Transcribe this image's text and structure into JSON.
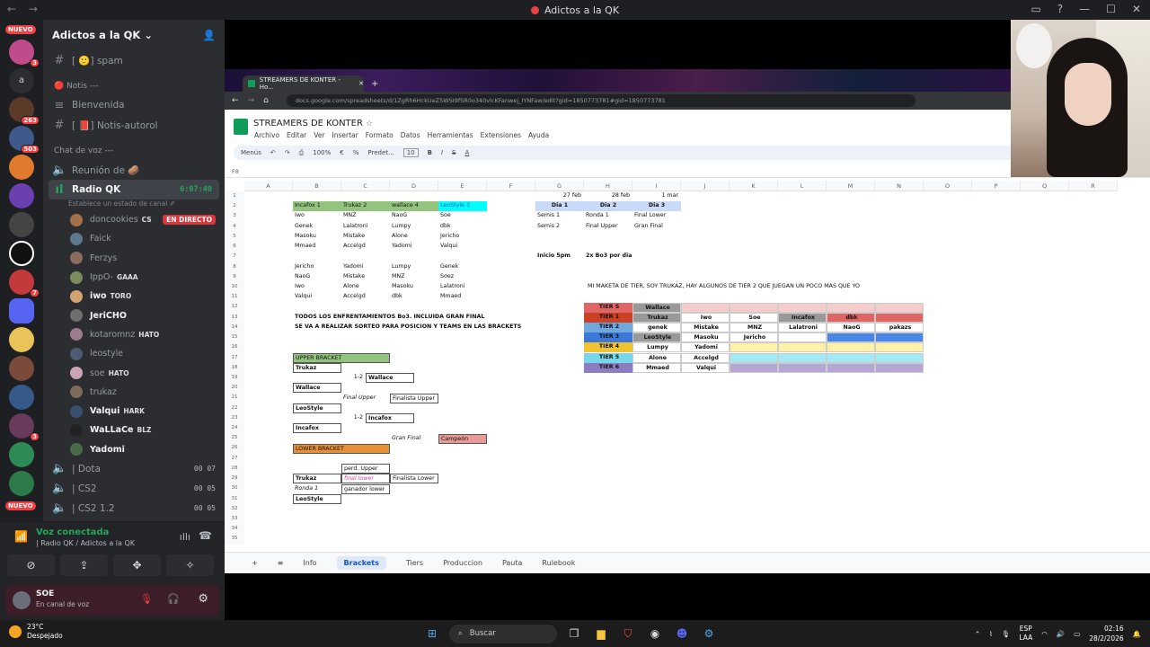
{
  "window": {
    "title": "Adictos a la QK"
  },
  "server": {
    "name": "Adictos a la QK",
    "rail_badges": [
      "NUEVO",
      "3",
      "263",
      "503",
      "7",
      "3",
      "NUEVO"
    ]
  },
  "channels": {
    "spam": "[ 🙂] spam",
    "notis_category": "🔴 Notis ---",
    "bienvenida": "Bienvenida",
    "notis_autorol": "[ 📕] Notis-autorol",
    "voice_category": "Chat de voz ---",
    "reunion": "Reunión de 🥔",
    "radio": "Radio QK",
    "radio_timer": "6:07:40",
    "radio_status": "Establece un estado de canal ✐",
    "dota": "| Dota",
    "dota_counts": "00 07",
    "cs2": "| CS2",
    "cs2_counts": "00 05",
    "cs2b": "| CS2 1.2",
    "cs2b_counts": "00 05"
  },
  "voice_users": [
    {
      "name": "doncookies",
      "tag": "CS",
      "live": "EN DIRECTO",
      "color": "#a3704a"
    },
    {
      "name": "Faick",
      "tag": "",
      "live": "",
      "color": "#5d7a8c"
    },
    {
      "name": "Ferzys",
      "tag": "",
      "live": "",
      "color": "#8a6b5e"
    },
    {
      "name": "IppO-",
      "tag": "GAAA",
      "live": "",
      "color": "#7a8c5d"
    },
    {
      "name": "iwo",
      "tag": "TORO",
      "live": "",
      "color": "#d4a373"
    },
    {
      "name": "JeriCHO",
      "tag": "",
      "live": "",
      "color": "#6e6e6e"
    },
    {
      "name": "kotaromnz",
      "tag": "HATO",
      "live": "",
      "color": "#9b7b8d"
    },
    {
      "name": "leostyle",
      "tag": "",
      "live": "",
      "color": "#4f5b73"
    },
    {
      "name": "soe",
      "tag": "HATO",
      "live": "",
      "color": "#c9a5b5"
    },
    {
      "name": "trukaz",
      "tag": "",
      "live": "",
      "color": "#7d6a5a"
    },
    {
      "name": "Valqui",
      "tag": "HARK",
      "live": "",
      "color": "#3b4f6e"
    },
    {
      "name": "WaLLaCe",
      "tag": "BLZ",
      "live": "",
      "color": "#222"
    },
    {
      "name": "Yadomi",
      "tag": "",
      "live": "",
      "color": "#4a6b4a"
    }
  ],
  "voice_panel": {
    "title": "Voz conectada",
    "sub": "| Radio QK / Adictos a la QK"
  },
  "user_panel": {
    "name": "SOE",
    "status": "En canal de voz"
  },
  "browser": {
    "tab": "STREAMERS DE KONTER - Ho...",
    "url": "docs.google.com/spreadsheets/d/1ZgRh6HckUeZ5WSI9fSR0o340vlcKFanwej_IYNFaw/edit?gid=1850773781#gid=1850773781"
  },
  "sheet": {
    "doc_title": "STREAMERS DE KONTER",
    "menus": [
      "Archivo",
      "Editar",
      "Ver",
      "Insertar",
      "Formato",
      "Datos",
      "Herramientas",
      "Extensiones",
      "Ayuda"
    ],
    "toolbar": [
      "Menús",
      "100%",
      "€",
      "%",
      "Predet...",
      "10"
    ],
    "name_box": "F8",
    "columns": [
      "A",
      "B",
      "C",
      "D",
      "E",
      "F",
      "G",
      "H",
      "I",
      "J",
      "K",
      "L",
      "M",
      "N",
      "O",
      "P",
      "Q",
      "R"
    ],
    "rows": [
      "1",
      "2",
      "3",
      "4",
      "5",
      "6",
      "7",
      "8",
      "9",
      "10",
      "11",
      "12",
      "13",
      "14",
      "15",
      "16",
      "17",
      "18",
      "19",
      "20",
      "21",
      "22",
      "23",
      "24",
      "25",
      "26",
      "27",
      "28",
      "29",
      "30",
      "31",
      "32",
      "33",
      "34",
      "35"
    ],
    "cells": {
      "b2": "Incafox 1",
      "c2": "Trukaz 2",
      "d2": "wallace 4",
      "e2": "LeoStyle 3",
      "b3": "Iwo",
      "c3": "MNZ",
      "d3": "NaoG",
      "e3": "Soe",
      "b4": "Genek",
      "c4": "Lalatroni",
      "d4": "Lumpy",
      "e4": "dbk",
      "b5": "Masoku",
      "c5": "Mistake",
      "d5": "Alone",
      "e5": "Jericho",
      "b6": "Mmaed",
      "c6": "Accelgd",
      "d6": "Yadomi",
      "e6": "Valqui",
      "b8": "Jericho",
      "c8": "Yadomi",
      "d8": "Lumpy",
      "e8": "Genek",
      "b9": "NaoG",
      "c9": "Mistake",
      "d9": "MNZ",
      "e9": "Soez",
      "b10": "Iwo",
      "c10": "Alone",
      "d10": "Masoku",
      "e10": "Lalatroni",
      "b11": "Valqui",
      "c11": "Accelgd",
      "d11": "dbk",
      "e11": "Mmaed",
      "g1": "27 feb",
      "h1": "28 feb",
      "i1": "1 mar",
      "g2": "Dia 1",
      "h2": "Dia 2",
      "i2": "Dia 3",
      "g3": "Semis 1",
      "h3": "Ronda 1",
      "i3": "Final Lower",
      "g4": "Semis 2",
      "h4": "Final Upper",
      "i4": "Gran Final",
      "g7": "Inicio 5pm",
      "h7": "2x Bo3 por dia",
      "note1": "TODOS LOS ENFRENTAMIENTOS Bo3. INCLUIDA GRAN FINAL",
      "note2": "SE VA A REALIZAR SORTEO PARA POSICION Y TEAMS EN LAS BRACKETS",
      "maketa": "MI MAKETA DE TIER, SOY TRUKAZ, HAY ALGUNOS DE TIER 2 QUE JUEGAN UN POCO MAS QUE YO",
      "upper": "UPPER BRACKET",
      "lower": "LOWER BRACKET",
      "b18": "Trukaz",
      "c19a": "1-2",
      "c19b": "Wallace",
      "b20": "Wallace",
      "c21": "Final Upper",
      "d21": "Finalista Upper",
      "b22": "LeoStyle",
      "c23a": "1-2",
      "c23b": "Incafox",
      "b24": "Incafox",
      "d25": "Gran Final",
      "e25": "Campeón",
      "c28": "perd. Upper",
      "b29": "Trukaz",
      "c29": "final lower",
      "d29": "Finalista Lower",
      "b30": "Ronda 1",
      "c30": "ganador lower",
      "b31": "LeoStyle"
    },
    "tiers": [
      {
        "label": "TIER S",
        "color": "#e06666",
        "cells": [
          "Wallace",
          "",
          "",
          "",
          "",
          ""
        ],
        "fills": [
          "#999999",
          "#f4cccc",
          "#f4cccc",
          "#f4cccc",
          "#f4cccc",
          "#f4cccc"
        ]
      },
      {
        "label": "TIER 1",
        "color": "#cc4125",
        "cells": [
          "Trukaz",
          "Iwo",
          "Soe",
          "Incafox",
          "dbk",
          ""
        ],
        "fills": [
          "#999999",
          "#ffffff",
          "#ffffff",
          "#999999",
          "#e06666",
          "#e06666"
        ]
      },
      {
        "label": "TIER 2",
        "color": "#6fa8dc",
        "cells": [
          "genek",
          "Mistake",
          "MNZ",
          "Lalatroni",
          "NaoG",
          "pakazs"
        ],
        "fills": [
          "#ffffff",
          "#ffffff",
          "#ffffff",
          "#ffffff",
          "#ffffff",
          "#ffffff"
        ]
      },
      {
        "label": "TIER 3",
        "color": "#3c78d8",
        "cells": [
          "LeoStyle",
          "Masoku",
          "Jericho",
          "",
          "",
          ""
        ],
        "fills": [
          "#999999",
          "#ffffff",
          "#ffffff",
          "#ffffff",
          "#4a86e8",
          "#4a86e8"
        ]
      },
      {
        "label": "TIER 4",
        "color": "#f1c232",
        "cells": [
          "Lumpy",
          "Yadomi",
          "",
          "",
          "",
          ""
        ],
        "fills": [
          "#ffffff",
          "#ffffff",
          "#fff2a8",
          "#fff2a8",
          "#fff2a8",
          "#fff2a8"
        ]
      },
      {
        "label": "TIER 5",
        "color": "#76d7ea",
        "cells": [
          "Alone",
          "Accelgd",
          "",
          "",
          "",
          ""
        ],
        "fills": [
          "#ffffff",
          "#ffffff",
          "#a2e8f5",
          "#a2e8f5",
          "#a2e8f5",
          "#a2e8f5"
        ]
      },
      {
        "label": "TIER 6",
        "color": "#8e7cc3",
        "cells": [
          "Mmaed",
          "Valqui",
          "",
          "",
          "",
          ""
        ],
        "fills": [
          "#ffffff",
          "#ffffff",
          "#b4a7d6",
          "#b4a7d6",
          "#b4a7d6",
          "#b4a7d6"
        ]
      }
    ],
    "tabs": [
      "Info",
      "Brackets",
      "Tiers",
      "Produccion",
      "Pauta",
      "Rulebook"
    ]
  },
  "taskbar": {
    "weather_temp": "23°C",
    "weather_desc": "Despejado",
    "search": "Buscar",
    "lang1": "ESP",
    "lang2": "LAA",
    "time": "02:16",
    "date": "28/2/2026"
  }
}
